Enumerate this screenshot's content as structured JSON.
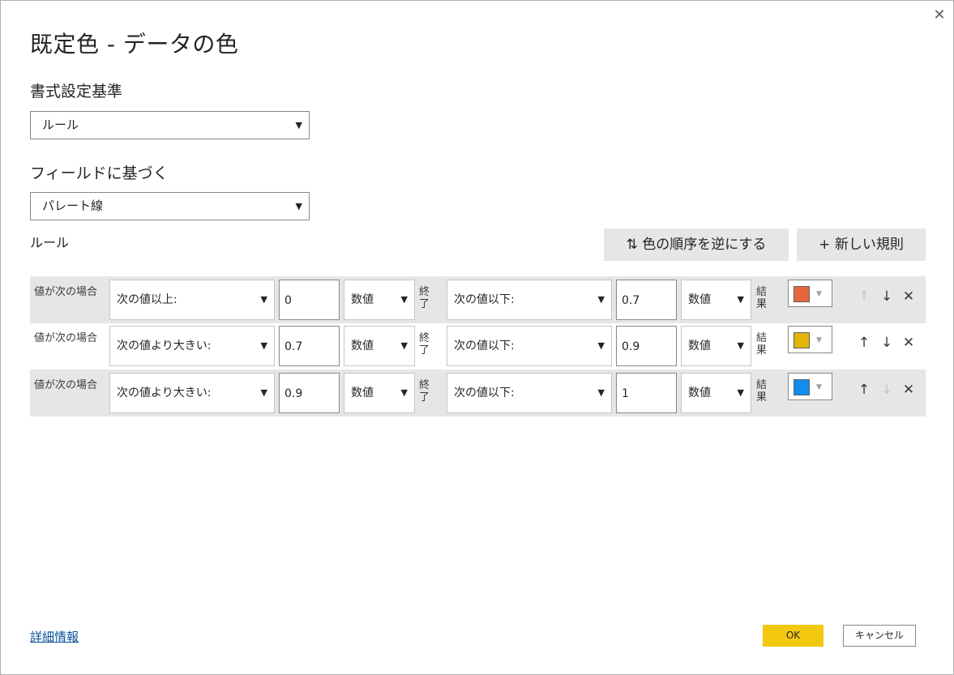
{
  "dialog": {
    "title": "既定色 - データの色",
    "close_icon": "close-icon"
  },
  "format_by": {
    "label": "書式設定基準",
    "value": "ルール"
  },
  "based_on_field": {
    "label": "フィールドに基づく",
    "value": "パレート線"
  },
  "rules": {
    "label": "ルール",
    "reverse_button": "⇅ 色の順序を逆にする",
    "new_rule_button": "+ 新しい規則",
    "if_label": "値が次の場合",
    "and_label": "終了",
    "then_label": "結果",
    "items": [
      {
        "cond1": "次の値以上:",
        "val1": "0",
        "type1": "数値",
        "cond2": "次の値以下:",
        "val2": "0.7",
        "type2": "数値",
        "color": "#e5673e",
        "shaded": true,
        "up_enabled": false
      },
      {
        "cond1": "次の値より大きい:",
        "val1": "0.7",
        "type1": "数値",
        "cond2": "次の値以下:",
        "val2": "0.9",
        "type2": "数値",
        "color": "#e2b50c",
        "shaded": false,
        "up_enabled": true
      },
      {
        "cond1": "次の値より大きい:",
        "val1": "0.9",
        "type1": "数値",
        "cond2": "次の値以下:",
        "val2": "1",
        "type2": "数値",
        "color": "#118df0",
        "shaded": true,
        "up_enabled": true
      }
    ]
  },
  "footer": {
    "learn_more": "詳細情報",
    "ok": "OK",
    "cancel": "キャンセル"
  },
  "colors": {
    "ok_button": "#f2c811",
    "row_shade": "#e6e6e6",
    "link": "#0d4f9e"
  }
}
